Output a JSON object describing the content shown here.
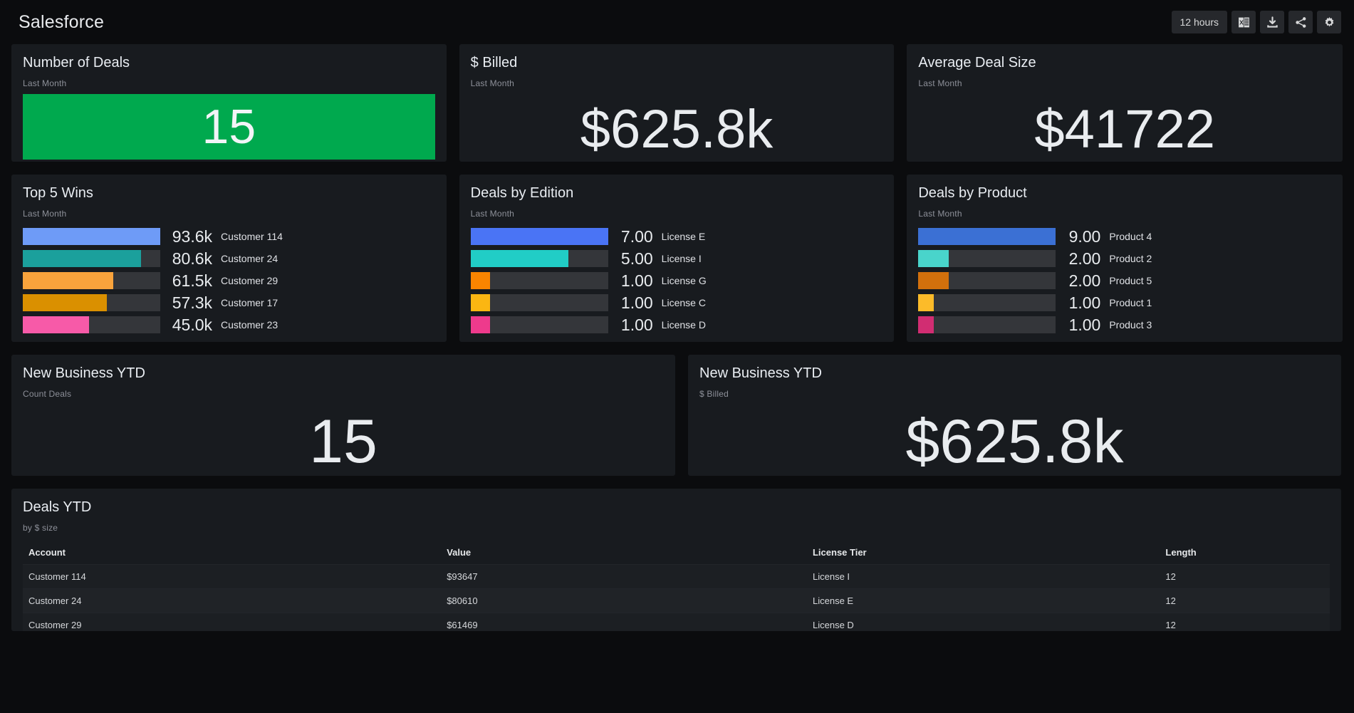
{
  "header": {
    "title": "Salesforce",
    "toolbar": {
      "time_range": "12 hours",
      "icons": [
        "excel-export-icon",
        "download-icon",
        "share-icon",
        "settings-gear-icon"
      ]
    }
  },
  "panels": {
    "number_of_deals": {
      "title": "Number of Deals",
      "subtitle": "Last Month",
      "value": "15",
      "bg_color": "#00a94e"
    },
    "billed": {
      "title": "$ Billed",
      "subtitle": "Last Month",
      "value": "$625.8k"
    },
    "average_deal_size": {
      "title": "Average Deal Size",
      "subtitle": "Last Month",
      "value": "$41722"
    },
    "top5_wins": {
      "title": "Top 5 Wins",
      "subtitle": "Last Month"
    },
    "deals_by_edition": {
      "title": "Deals by Edition",
      "subtitle": "Last Month"
    },
    "deals_by_product": {
      "title": "Deals by Product",
      "subtitle": "Last Month"
    },
    "new_business_count": {
      "title": "New Business YTD",
      "subtitle": "Count Deals",
      "value": "15"
    },
    "new_business_billed": {
      "title": "New Business YTD",
      "subtitle": "$ Billed",
      "value": "$625.8k"
    },
    "deals_ytd": {
      "title": "Deals YTD",
      "subtitle": "by $ size"
    }
  },
  "chart_data": [
    {
      "type": "bar",
      "title": "Top 5 Wins",
      "subtitle": "Last Month",
      "orientation": "horizontal",
      "categories": [
        "Customer 114",
        "Customer 24",
        "Customer 29",
        "Customer 17",
        "Customer 23"
      ],
      "values": [
        93600,
        80600,
        61500,
        57300,
        45000
      ],
      "display_values": [
        "93.6k",
        "80.6k",
        "61.5k",
        "57.3k",
        "45.0k"
      ],
      "percents": [
        100,
        86.1,
        65.7,
        61.2,
        48.1
      ],
      "colors": [
        "#6e9bf7",
        "#1ba09c",
        "#f9a33c",
        "#da9000",
        "#f75aa8"
      ],
      "track_color": "#34363a",
      "xlabel": "",
      "ylabel": "",
      "legend": "none",
      "grid": false
    },
    {
      "type": "bar",
      "title": "Deals by Edition",
      "subtitle": "Last Month",
      "orientation": "horizontal",
      "categories": [
        "License E",
        "License I",
        "License G",
        "License C",
        "License D"
      ],
      "values": [
        7,
        5,
        1,
        1,
        1
      ],
      "display_values": [
        "7.00",
        "5.00",
        "1.00",
        "1.00",
        "1.00"
      ],
      "percents": [
        100,
        71.4,
        14.3,
        14.3,
        14.3
      ],
      "colors": [
        "#4a74f5",
        "#21cdc6",
        "#f98400",
        "#fbb612",
        "#ee3a8c"
      ],
      "track_color": "#34363a",
      "xlabel": "",
      "ylabel": "",
      "legend": "none",
      "grid": false
    },
    {
      "type": "bar",
      "title": "Deals by Product",
      "subtitle": "Last Month",
      "orientation": "horizontal",
      "categories": [
        "Product 4",
        "Product 2",
        "Product 5",
        "Product 1",
        "Product 3"
      ],
      "values": [
        9,
        2,
        2,
        1,
        1
      ],
      "display_values": [
        "9.00",
        "2.00",
        "2.00",
        "1.00",
        "1.00"
      ],
      "percents": [
        100,
        22.2,
        22.2,
        11.1,
        11.1
      ],
      "colors": [
        "#3b70d4",
        "#49d4cb",
        "#d2700c",
        "#fcbb29",
        "#d12d72"
      ],
      "track_color": "#34363a",
      "xlabel": "",
      "ylabel": "",
      "legend": "none",
      "grid": false
    },
    {
      "type": "table",
      "title": "Deals YTD",
      "subtitle": "by $ size",
      "columns": [
        "Account",
        "Value",
        "License Tier",
        "Length"
      ],
      "rows": [
        [
          "Customer 114",
          "$93647",
          "License I",
          "12"
        ],
        [
          "Customer 24",
          "$80610",
          "License E",
          "12"
        ],
        [
          "Customer 29",
          "$61469",
          "License D",
          "12"
        ]
      ]
    }
  ]
}
